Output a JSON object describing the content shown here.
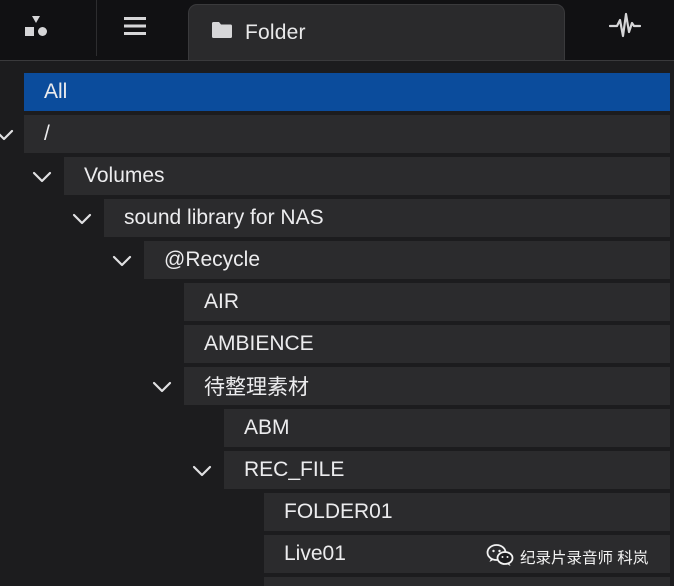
{
  "tabs": {
    "tab_hierarchy_icon": "hierarchy-icon",
    "tab_list_icon": "list-icon",
    "active_tab_label": "Folder",
    "active_tab_icon": "folder-icon",
    "tab_waveform_icon": "waveform-icon"
  },
  "tree": {
    "rows": [
      {
        "label": "All",
        "selected": true
      },
      {
        "label": "/",
        "expanded": true
      },
      {
        "label": "Volumes",
        "expanded": true
      },
      {
        "label": "sound library for NAS",
        "expanded": true
      },
      {
        "label": "@Recycle",
        "expanded": true
      },
      {
        "label": "AIR"
      },
      {
        "label": "AMBIENCE"
      },
      {
        "label": "待整理素材",
        "expanded": true
      },
      {
        "label": "ABM"
      },
      {
        "label": "REC_FILE",
        "expanded": true
      },
      {
        "label": "FOLDER01"
      },
      {
        "label": "Live01"
      }
    ]
  },
  "watermark": {
    "text": "纪录片录音师 科岚",
    "icon": "wechat-icon"
  },
  "colors": {
    "selected_row": "#0b4c9c",
    "row_bg": "#2b2b2d",
    "background": "#1c1c1e",
    "tabbar_bg": "#111113",
    "active_tab_bg": "#2a2a2c",
    "text": "#ececee",
    "icon": "#d6d6d8"
  }
}
